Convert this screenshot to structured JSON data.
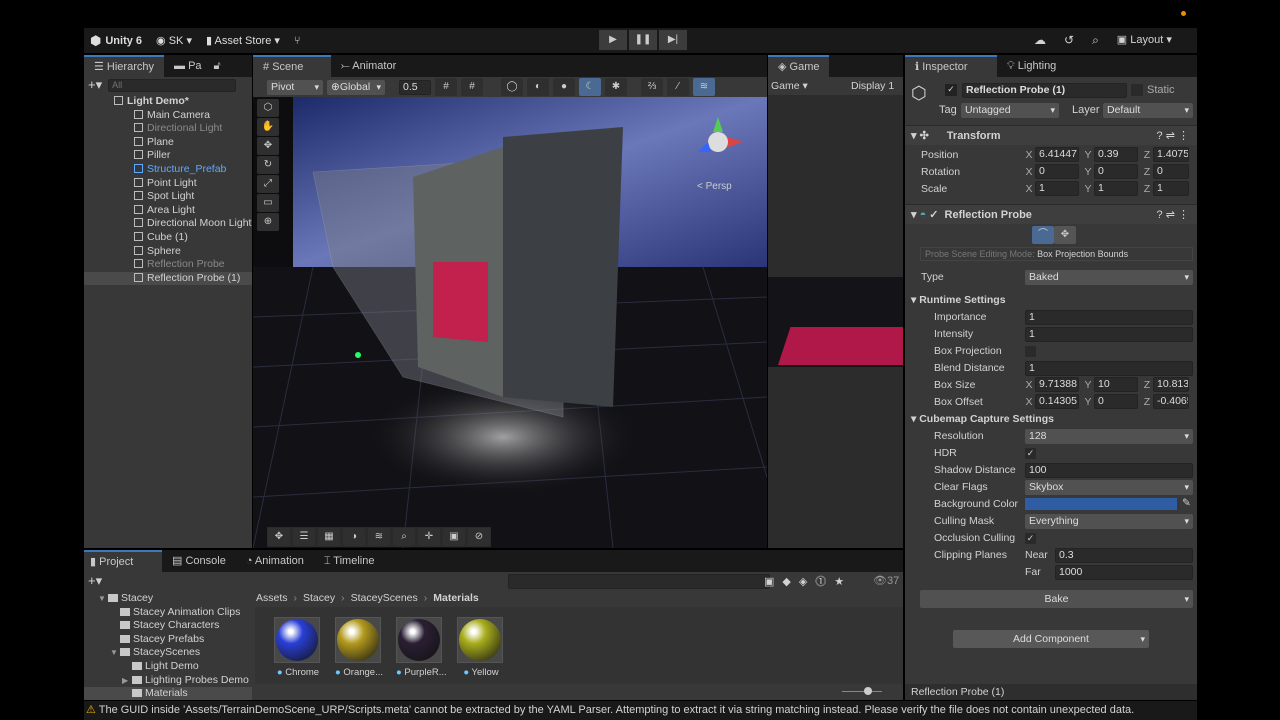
{
  "topbar": {
    "app": "Unity 6",
    "account": "SK",
    "asset_store": "Asset Store",
    "layout": "Layout"
  },
  "hierarchy": {
    "tab": "Hierarchy",
    "tab2": "Pa",
    "search_placeholder": "All",
    "items": [
      {
        "label": "Light Demo*",
        "indent": 0,
        "style": "scene"
      },
      {
        "label": "Main Camera",
        "indent": 1,
        "style": ""
      },
      {
        "label": "Directional Light",
        "indent": 1,
        "style": "dim"
      },
      {
        "label": "Plane",
        "indent": 1,
        "style": ""
      },
      {
        "label": "Piller",
        "indent": 1,
        "style": ""
      },
      {
        "label": "Structure_Prefab",
        "indent": 1,
        "style": "blue"
      },
      {
        "label": "Point Light",
        "indent": 1,
        "style": ""
      },
      {
        "label": "Spot Light",
        "indent": 1,
        "style": ""
      },
      {
        "label": "Area Light",
        "indent": 1,
        "style": ""
      },
      {
        "label": "Directional Moon Light",
        "indent": 1,
        "style": ""
      },
      {
        "label": "Cube (1)",
        "indent": 1,
        "style": ""
      },
      {
        "label": "Sphere",
        "indent": 1,
        "style": ""
      },
      {
        "label": "Reflection Probe",
        "indent": 1,
        "style": "dim"
      },
      {
        "label": "Reflection Probe (1)",
        "indent": 1,
        "style": "sel"
      }
    ]
  },
  "scene": {
    "tab": "Scene",
    "tab2": "Animator",
    "pivot": "Pivot",
    "global": "Global",
    "snap": "0.5",
    "persp": "< Persp"
  },
  "game": {
    "tab": "Game",
    "mode": "Game",
    "display": "Display 1"
  },
  "inspector": {
    "tab": "Inspector",
    "tab2": "Lighting",
    "object_name": "Reflection Probe (1)",
    "static": "Static",
    "tag_label": "Tag",
    "tag": "Untagged",
    "layer_label": "Layer",
    "layer": "Default",
    "transform": {
      "title": "Transform",
      "position": [
        "6.41447",
        "0.39",
        "1.40755"
      ],
      "rotation": [
        "0",
        "0",
        "0"
      ],
      "scale": [
        "1",
        "1",
        "1"
      ],
      "labels": [
        "Position",
        "Rotation",
        "Scale"
      ]
    },
    "probe": {
      "title": "Reflection Probe",
      "edit_mode_label": "Probe Scene Editing Mode:",
      "edit_mode": "Box Projection Bounds",
      "type_label": "Type",
      "type": "Baked",
      "runtime": "Runtime Settings",
      "importance_label": "Importance",
      "importance": "1",
      "intensity_label": "Intensity",
      "intensity": "1",
      "box_projection_label": "Box Projection",
      "blend_label": "Blend Distance",
      "blend": "1",
      "box_size_label": "Box Size",
      "box_size": [
        "9.71388",
        "10",
        "10.8131"
      ],
      "box_offset_label": "Box Offset",
      "box_offset": [
        "0.14305",
        "0",
        "-0.4065"
      ],
      "cubemap": "Cubemap Capture Settings",
      "resolution_label": "Resolution",
      "resolution": "128",
      "hdr_label": "HDR",
      "shadow_label": "Shadow Distance",
      "shadow": "100",
      "clear_label": "Clear Flags",
      "clear": "Skybox",
      "bg_label": "Background Color",
      "bg_color": "#2f5da3",
      "culling_label": "Culling Mask",
      "culling": "Everything",
      "occlusion_label": "Occlusion Culling",
      "clipping_label": "Clipping Planes",
      "near_label": "Near",
      "near": "0.3",
      "far_label": "Far",
      "far": "1000",
      "bake": "Bake"
    },
    "add_component": "Add Component",
    "footer": "Reflection Probe (1)"
  },
  "project": {
    "tabs": [
      "Project",
      "Console",
      "Animation",
      "Timeline"
    ],
    "count": "37",
    "tree": [
      {
        "label": "Stacey",
        "indent": 0,
        "arrow": "▼"
      },
      {
        "label": "Stacey Animation Clips",
        "indent": 1,
        "arrow": ""
      },
      {
        "label": "Stacey Characters",
        "indent": 1,
        "arrow": ""
      },
      {
        "label": "Stacey Prefabs",
        "indent": 1,
        "arrow": ""
      },
      {
        "label": "StaceyScenes",
        "indent": 1,
        "arrow": "▼"
      },
      {
        "label": "Light Demo",
        "indent": 2,
        "arrow": ""
      },
      {
        "label": "Lighting Probes Demo",
        "indent": 2,
        "arrow": "▶"
      },
      {
        "label": "Materials",
        "indent": 2,
        "arrow": ""
      }
    ],
    "breadcrumb": [
      "Assets",
      "Stacey",
      "StaceyScenes",
      "Materials"
    ],
    "materials": [
      {
        "name": "Chrome",
        "color": "#2a3fd6"
      },
      {
        "name": "Orange...",
        "color": "#b39a1e"
      },
      {
        "name": "PurpleR...",
        "color": "#2a1f33"
      },
      {
        "name": "Yellow",
        "color": "#a8ad1c"
      }
    ]
  },
  "status": {
    "message": "The GUID inside 'Assets/TerrainDemoScene_URP/Scripts.meta' cannot be extracted by the YAML Parser. Attempting to extract it via string matching instead. Please verify the file does not contain unexpected data."
  }
}
